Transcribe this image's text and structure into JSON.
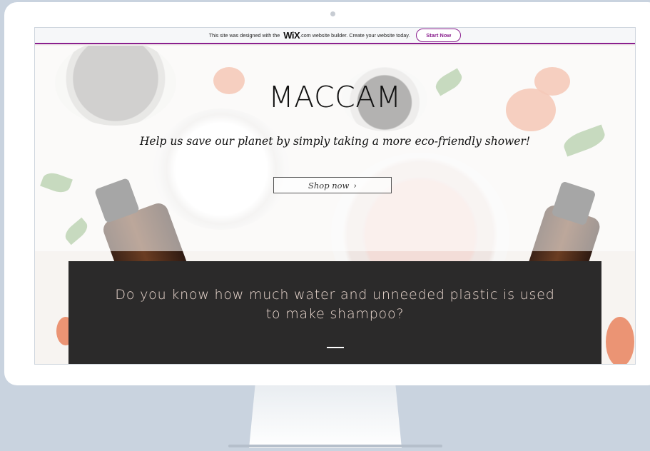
{
  "banner": {
    "text_before": "This site was designed with the",
    "logo": "WiX",
    "text_after": ".com website builder. Create your website today.",
    "cta": "Start Now"
  },
  "hero": {
    "title": "MACCAM",
    "tagline": "Help us save our planet by simply taking a more eco-friendly shower!",
    "shop_button": "Shop now",
    "shop_arrow": "›"
  },
  "info": {
    "text": "Do you know how much water and unneeded plastic is used to make shampoo?"
  },
  "colors": {
    "accent": "#8a1f8e",
    "panel": "#2b2a2a",
    "panel_text": "#ead8cf",
    "backdrop": "#c9d3df"
  }
}
